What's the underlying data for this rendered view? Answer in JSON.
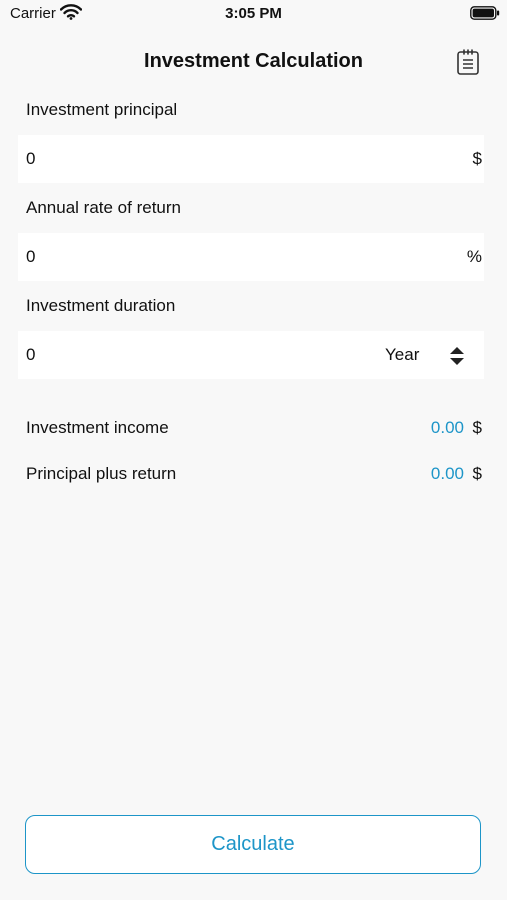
{
  "status_bar": {
    "carrier": "Carrier",
    "time": "3:05 PM"
  },
  "header": {
    "title": "Investment Calculation",
    "right_icon": "clipboard-icon"
  },
  "form": {
    "principal": {
      "label": "Investment principal",
      "value": "0",
      "unit": "$"
    },
    "rate": {
      "label": "Annual rate of return",
      "value": "0",
      "unit": "%"
    },
    "duration": {
      "label": "Investment duration",
      "value": "0",
      "unit": "Year"
    }
  },
  "results": {
    "income": {
      "label": "Investment income",
      "value": "0.00",
      "unit": "$"
    },
    "total": {
      "label": "Principal plus return",
      "value": "0.00",
      "unit": "$"
    }
  },
  "actions": {
    "calculate_label": "Calculate"
  },
  "colors": {
    "accent": "#1d95c8",
    "background": "#f8f8f8",
    "field": "#ffffff"
  }
}
